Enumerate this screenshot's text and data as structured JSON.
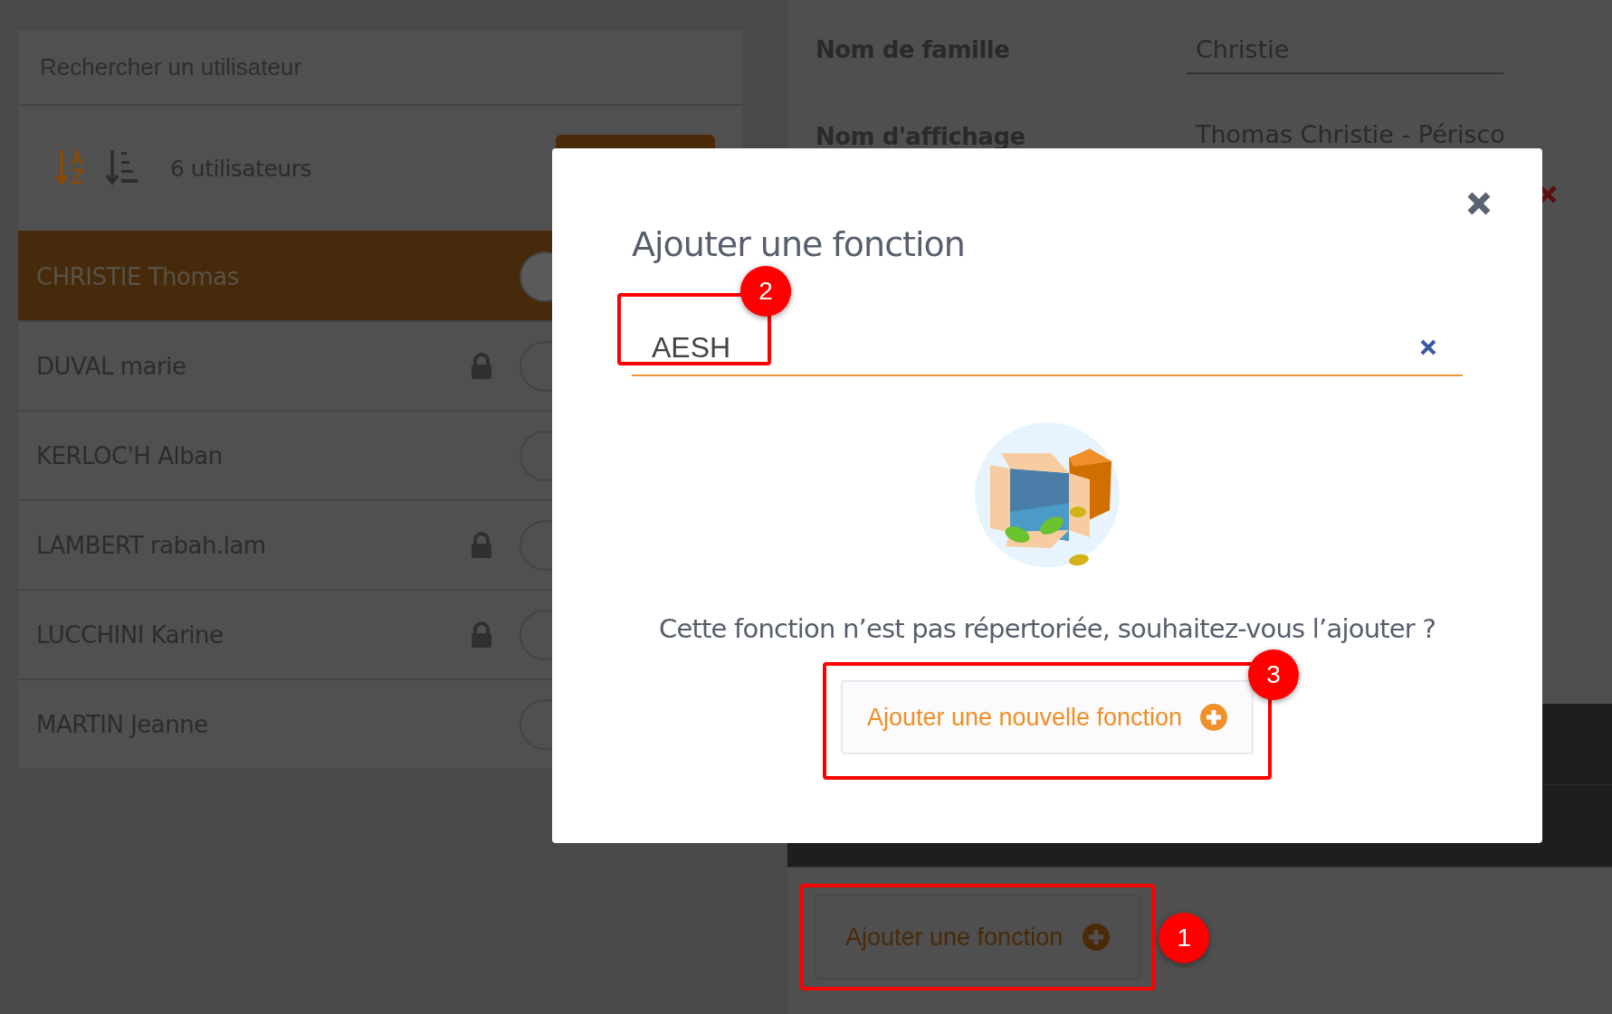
{
  "user_list": {
    "search": {
      "placeholder": "Rechercher un utilisateur"
    },
    "count": "6 utilisateurs",
    "users": [
      {
        "name": "CHRISTIE Thomas",
        "selected": true,
        "locked": false
      },
      {
        "name": "DUVAL marie",
        "selected": false,
        "locked": true
      },
      {
        "name": "KERLOC'H Alban",
        "selected": false,
        "locked": false
      },
      {
        "name": "LAMBERT rabah.lam",
        "selected": false,
        "locked": true
      },
      {
        "name": "LUCCHINI Karine",
        "selected": false,
        "locked": true
      },
      {
        "name": "MARTIN Jeanne",
        "selected": false,
        "locked": false
      }
    ]
  },
  "user_detail": {
    "fields": [
      {
        "label": "Nom de famille",
        "value": "Christie"
      },
      {
        "label": "Nom d'affichage",
        "value": "Thomas Christie - Périsco"
      }
    ],
    "add_function_button": {
      "label": "Ajouter une fonction",
      "annotation": "1"
    }
  },
  "modal": {
    "title": "Ajouter une fonction",
    "search": {
      "value": "AESH",
      "annotation": "2"
    },
    "message": "Cette fonction n’est pas répertoriée, souhaitez-vous l’ajouter ?",
    "add_button": {
      "label": "Ajouter une nouvelle fonction",
      "annotation": "3"
    }
  }
}
